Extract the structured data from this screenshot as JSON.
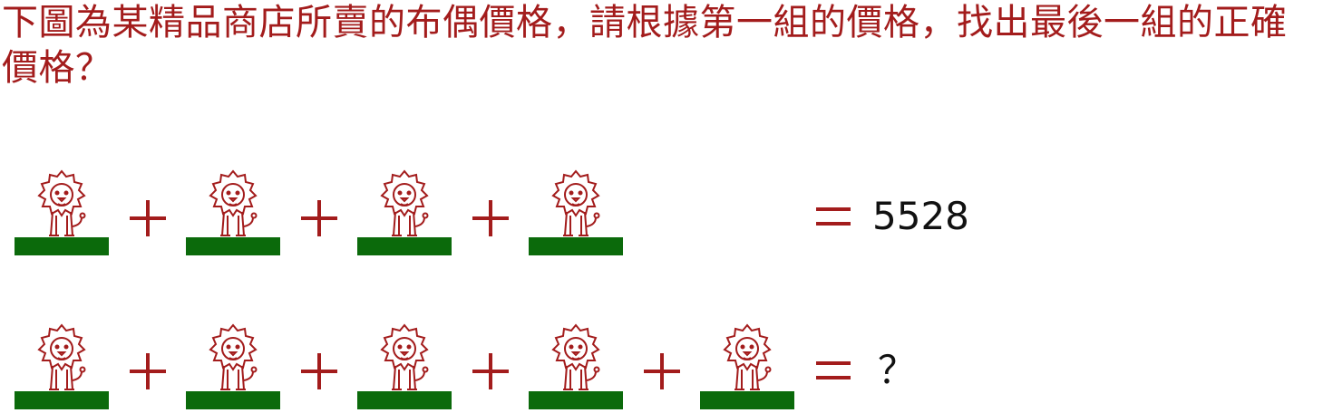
{
  "question": "下圖為某精品商店所賣的布偶價格，請根據第一組的價格，找出最後一組的正確價格？",
  "rows": [
    {
      "result": "5528"
    },
    {
      "result": "？"
    }
  ],
  "colors": {
    "text": "#a31c1c",
    "ground": "#0b6a0b",
    "lion_stroke": "#a31c1c"
  },
  "icons": {
    "item": "lion-icon",
    "ground": "grass-strip",
    "operator": "plus-icon",
    "equals": "equals-icon"
  }
}
